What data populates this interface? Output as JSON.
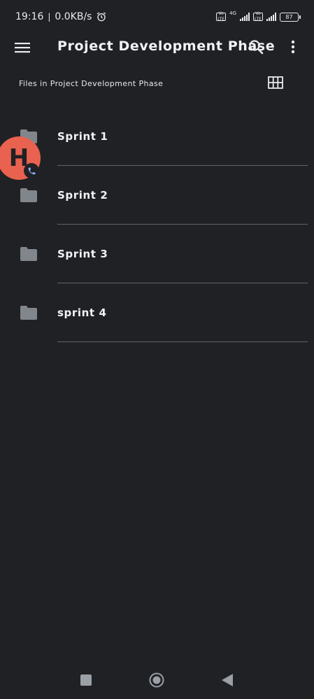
{
  "status_bar": {
    "time": "19:16",
    "separator": "|",
    "net_speed": "0.0KB/s",
    "volte1": "Vo LTE",
    "network_type": "4G",
    "volte2": "Vo LTE",
    "battery": "87"
  },
  "app_bar": {
    "title": "Project Development Phase"
  },
  "subheader": {
    "label": "Files in Project Development Phase"
  },
  "files": [
    {
      "name": "Sprint 1"
    },
    {
      "name": "Sprint 2"
    },
    {
      "name": "Sprint 3"
    },
    {
      "name": "sprint 4"
    }
  ],
  "chat_head": {
    "initial": "H"
  },
  "colors": {
    "background": "#202125",
    "chat_head": "#e8624f",
    "folder": "#80868b",
    "divider": "#5f6368",
    "call_badge_icon": "#8ab4f8"
  },
  "icons": {
    "menu": "menu-icon",
    "search": "search-icon",
    "more": "more-vert-icon",
    "grid": "grid-view-icon",
    "folder": "folder-icon",
    "alarm": "alarm-icon",
    "phone": "phone-icon"
  }
}
